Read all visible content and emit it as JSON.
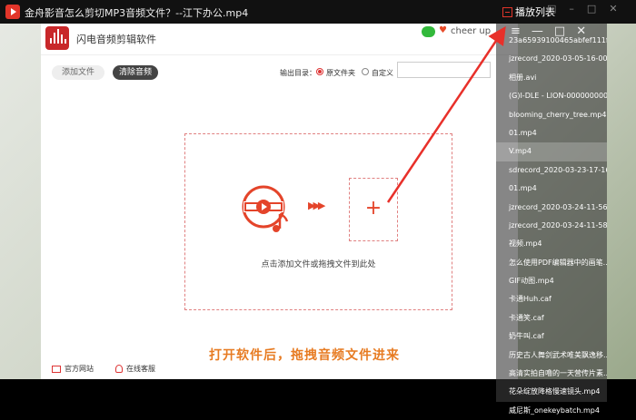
{
  "topbar": {
    "brand": "金舟影音",
    "media_title": "怎么剪切MP3音频文件？--江下办公.mp4",
    "playlist_button": "播放列表",
    "controls": [
      "□",
      "–",
      "□",
      "✕"
    ]
  },
  "app": {
    "name": "闪电音频剪辑软件",
    "user": "cheer up",
    "window_controls": [
      "≡",
      "—",
      "□",
      "✕"
    ],
    "toolbar": {
      "add_file": "添加文件",
      "clear_audio": "清除音频",
      "output_dir_label": "输出目录：",
      "option_source": "原文件夹",
      "option_custom": "自定义"
    },
    "dropzone": {
      "hint": "点击添加文件或拖拽文件到此处",
      "arrows": "▶▶▶",
      "plus": "+"
    },
    "footer": {
      "website": "官方网站",
      "service": "在线客服"
    }
  },
  "caption": "打开软件后，拖拽音频文件进来",
  "playlist": {
    "controls": [
      "≡",
      "—",
      "□",
      "✕"
    ],
    "items": [
      "23a65939100465abfef111fd...",
      "jzrecord_2020-03-05-16-00-...",
      "相册.avi",
      "(G)I-DLE - LION-000000000...",
      "blooming_cherry_tree.mp4",
      "01.mp4",
      "V.mp4",
      "sdrecord_2020-03-23-17-16...",
      "01.mp4",
      "jzrecord_2020-03-24-11-56-...",
      "jzrecord_2020-03-24-11-58-...",
      "视频.mp4",
      "怎么使用PDF编辑器中的画笔...",
      "GIF动图.mp4",
      "卡通Huh.caf",
      "卡通笑.caf",
      "奶牛叫.caf",
      "历史古人舞剑武术唯美飘逸移...",
      "高清实拍自噜的一天营传片素...",
      "花朵绽放降格慢速镜头.mp4",
      "威尼斯_onekeybatch.mp4"
    ],
    "selected_index": 6
  },
  "colors": {
    "brand_red": "#e2352a",
    "caption_orange": "#e77b22",
    "annotation_red": "#e8302a"
  }
}
